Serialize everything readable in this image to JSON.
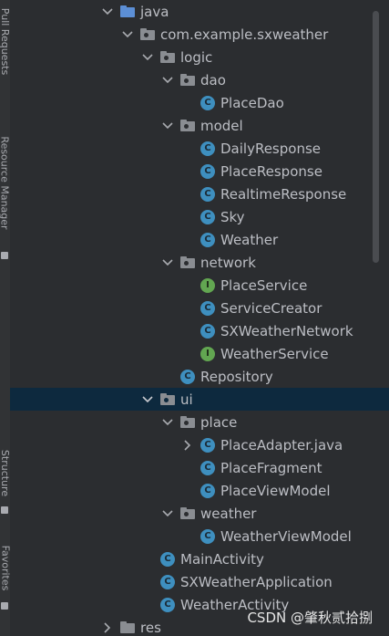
{
  "side_tabs": {
    "pull_requests": "Pull Requests",
    "resource_manager": "Resource Manager",
    "structure": "Structure",
    "favorites": "Favorites"
  },
  "tree": {
    "java": "java",
    "package": "com.example.sxweather",
    "logic": "logic",
    "dao": "dao",
    "place_dao": "PlaceDao",
    "model": "model",
    "daily_response": "DailyResponse",
    "place_response": "PlaceResponse",
    "realtime_response": "RealtimeResponse",
    "sky": "Sky",
    "weather": "Weather",
    "network": "network",
    "place_service": "PlaceService",
    "service_creator": "ServiceCreator",
    "sxweather_network": "SXWeatherNetwork",
    "weather_service": "WeatherService",
    "repository": "Repository",
    "ui": "ui",
    "place": "place",
    "place_adapter": "PlaceAdapter.java",
    "place_fragment": "PlaceFragment",
    "place_view_model": "PlaceViewModel",
    "weather_pkg": "weather",
    "weather_view_model": "WeatherViewModel",
    "main_activity": "MainActivity",
    "sxweather_application": "SXWeatherApplication",
    "weather_activity": "WeatherActivity",
    "res": "res"
  },
  "icon_letters": {
    "class": "C",
    "interface": "I"
  },
  "watermark": "CSDN @肇秋贰拾捌",
  "colors": {
    "background": "#2b2d30",
    "selection": "#0d293e",
    "class_icon": "#3e8fbf",
    "interface_icon": "#62a651",
    "folder": "#8a8d92",
    "source_folder": "#5c8fd6"
  }
}
